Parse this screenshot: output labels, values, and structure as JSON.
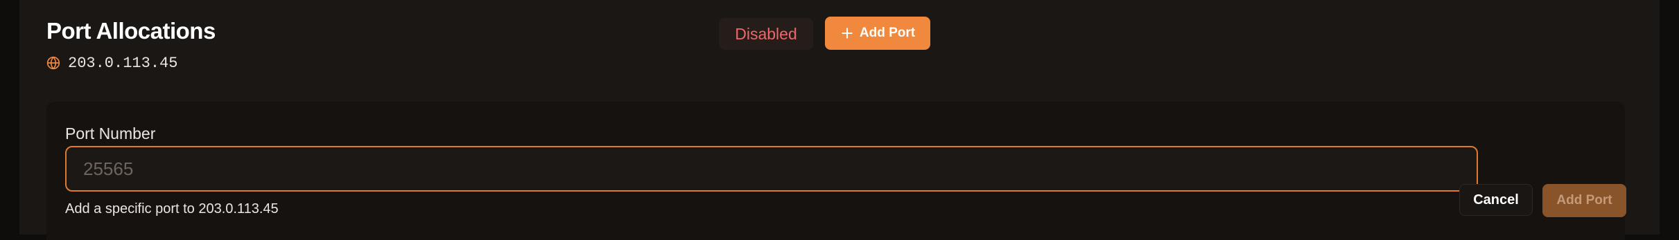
{
  "section": {
    "title": "Port Allocations",
    "ip_address": "203.0.113.45",
    "status": "Disabled",
    "add_port_label": "Add Port"
  },
  "form": {
    "port_label": "Port Number",
    "port_placeholder": "25565",
    "port_value": "",
    "helper_text": "Add a specific port to 203.0.113.45",
    "cancel_label": "Cancel",
    "submit_label": "Add Port"
  },
  "icons": {
    "ip": "globe-icon",
    "add": "plus-icon"
  },
  "colors": {
    "accent": "#f0893d",
    "accent_disabled": "#8a542a",
    "status_disabled": "#f0676a",
    "input_focus_border": "#e07a2e"
  }
}
